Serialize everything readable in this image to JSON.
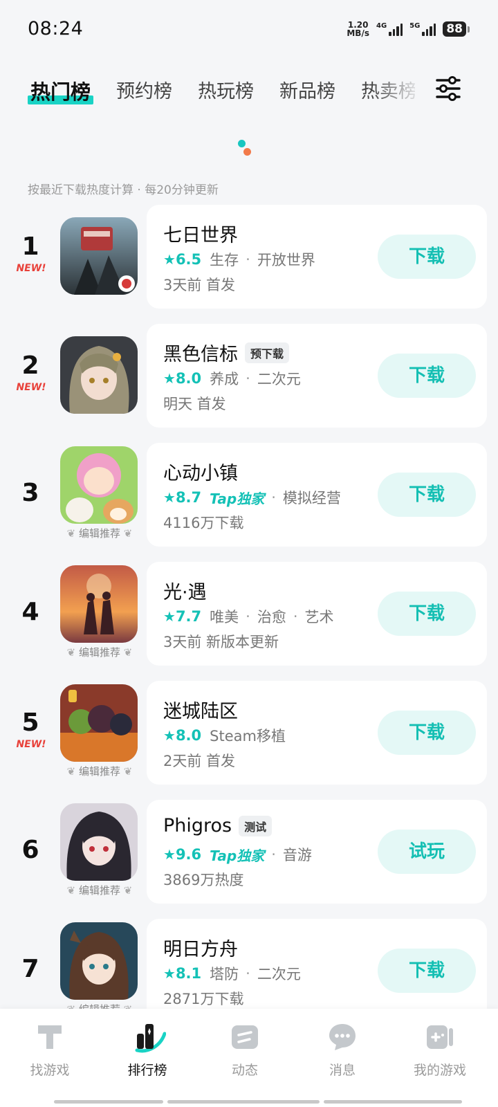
{
  "status_bar": {
    "time": "08:24",
    "speed_value": "1.20",
    "speed_unit": "MB/s",
    "net1": "4G",
    "net2": "5G",
    "battery": "88"
  },
  "tabs": [
    {
      "label": "热门榜",
      "active": true
    },
    {
      "label": "预约榜",
      "active": false
    },
    {
      "label": "热玩榜",
      "active": false
    },
    {
      "label": "新品榜",
      "active": false
    },
    {
      "label": "热卖榜",
      "active": false
    }
  ],
  "hint": "按最近下载热度计算 · 每20分钟更新",
  "editor_label": "编辑推荐",
  "games": [
    {
      "rank": "1",
      "new": "NEW!",
      "name": "七日世界",
      "badge": "",
      "score": "6.5",
      "tap": "",
      "tags": [
        "生存",
        "开放世界"
      ],
      "sub": "3天前 首发",
      "button": "下载"
    },
    {
      "rank": "2",
      "new": "NEW!",
      "name": "黑色信标",
      "badge": "预下载",
      "score": "8.0",
      "tap": "",
      "tags": [
        "养成",
        "二次元"
      ],
      "sub": "明天 首发",
      "button": "下载"
    },
    {
      "rank": "3",
      "new": "",
      "name": "心动小镇",
      "badge": "",
      "score": "8.7",
      "tap": "Tap独家",
      "tags": [
        "模拟经营"
      ],
      "sub": "4116万下载",
      "button": "下载"
    },
    {
      "rank": "4",
      "new": "",
      "name": "光·遇",
      "badge": "",
      "score": "7.7",
      "tap": "",
      "tags": [
        "唯美",
        "治愈",
        "艺术"
      ],
      "sub": "3天前 新版本更新",
      "button": "下载"
    },
    {
      "rank": "5",
      "new": "NEW!",
      "name": "迷城陆区",
      "badge": "",
      "score": "8.0",
      "tap": "",
      "tags": [
        "Steam移植"
      ],
      "sub": "2天前 首发",
      "button": "下载"
    },
    {
      "rank": "6",
      "new": "",
      "name": "Phigros",
      "badge": "测试",
      "score": "9.6",
      "tap": "Tap独家",
      "tags": [
        "音游"
      ],
      "sub": "3869万热度",
      "button": "试玩"
    },
    {
      "rank": "7",
      "new": "",
      "name": "明日方舟",
      "badge": "",
      "score": "8.1",
      "tap": "",
      "tags": [
        "塔防",
        "二次元"
      ],
      "sub": "2871万下载",
      "button": "下载"
    }
  ],
  "bottom_nav": [
    {
      "label": "找游戏",
      "icon": "game-search-icon",
      "active": false
    },
    {
      "label": "排行榜",
      "icon": "ranking-icon",
      "active": true
    },
    {
      "label": "动态",
      "icon": "feed-icon",
      "active": false
    },
    {
      "label": "消息",
      "icon": "message-icon",
      "active": false
    },
    {
      "label": "我的游戏",
      "icon": "my-games-icon",
      "active": false
    }
  ],
  "colors": {
    "accent": "#19d3c5",
    "button_bg": "#e4f8f6",
    "new_red": "#e8413a"
  }
}
